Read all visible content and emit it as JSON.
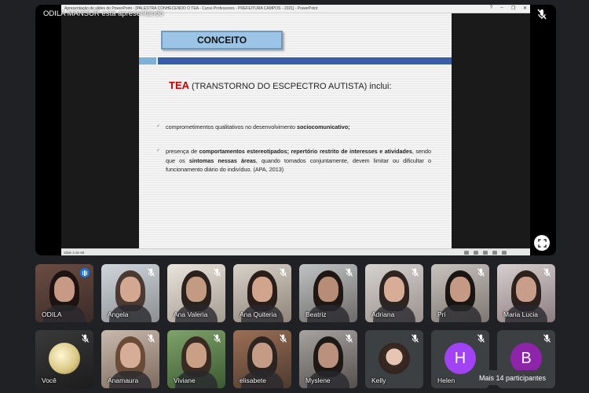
{
  "presenter": {
    "label": "ODILA MANSUR está apresentando"
  },
  "ppt": {
    "window_title": "Apresentação de slides do PowerPoint - [PALESTRA CONHECENDO O TEA - Curso Professores - PREFEITURA CAMPOS - 2021] - PowerPoint",
    "status_text": "Slide 3 de 68"
  },
  "slide": {
    "title": "CONCEITO",
    "heading_tea": "TEA",
    "heading_rest": " (TRANSTORNO DO ESCPECTRO AUTISTA) inclui:",
    "bullet1_a": "comprometimentos qualitativos no desenvolvimento ",
    "bullet1_b": "sociocomunicativo",
    "bullet1_c": ";",
    "bullet2_a": "presença de ",
    "bullet2_b": "comportamentos estereotipados; repertório restrito de interesses e atividades",
    "bullet2_c": ", sendo que os ",
    "bullet2_d": "sintomas nessas áreas",
    "bullet2_e": ", quando tomados conjuntamente, devem limitar ou dificultar o funcionamento diário do indivíduo. (APA, 2013)"
  },
  "participants": [
    {
      "name": "ODILA"
    },
    {
      "name": "Angela"
    },
    {
      "name": "Ana Valeria"
    },
    {
      "name": "Ana Quiteria"
    },
    {
      "name": "Beatriz"
    },
    {
      "name": "Adriana"
    },
    {
      "name": "Pri"
    },
    {
      "name": "Maria Lucia"
    },
    {
      "name": "Você"
    },
    {
      "name": "Anamaura"
    },
    {
      "name": "Viviane"
    },
    {
      "name": "elisabete"
    },
    {
      "name": "Myslene"
    },
    {
      "name": "Kelly"
    },
    {
      "name": "Helen",
      "initial": "H",
      "color": "#a142f4"
    },
    {
      "name": "B",
      "initial": "B",
      "color": "#8e24aa"
    }
  ],
  "overflow": {
    "label": "Mais 14 participantes"
  },
  "colors": {
    "background": "#202124",
    "tea_red": "#c00000",
    "slide_blue": "#3a5da8"
  }
}
